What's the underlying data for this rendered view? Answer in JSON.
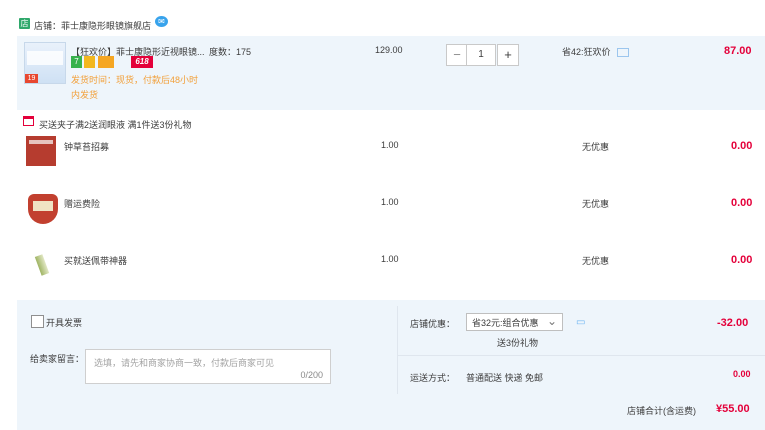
{
  "shop": {
    "icon_text": "店",
    "label": "店铺：菲士康隐形眼镜旗舰店",
    "chat_glyph": "✉"
  },
  "item": {
    "title": "【狂欢价】菲士康隐形近视眼镜...",
    "attr": "度数：175",
    "price": "129.00",
    "quantity": "1",
    "minus": "−",
    "plus": "+",
    "discount": "省42:狂欢价",
    "total": "87.00",
    "ship_info_1": "发货时间：现货，付款后48小时",
    "ship_info_2": "内发货",
    "badges": [
      "7",
      "",
      "",
      "618"
    ],
    "thumb_badge": "19"
  },
  "promo": {
    "text": "买送夹子满2送润眼液  满1件送3份礼物"
  },
  "gifts": [
    {
      "name": "钟草苔招募",
      "price": "1.00",
      "discount": "无优惠",
      "total": "0.00"
    },
    {
      "name": "赠运费险",
      "price": "1.00",
      "discount": "无优惠",
      "total": "0.00"
    },
    {
      "name": "买就送佩带神器",
      "price": "1.00",
      "discount": "无优惠",
      "total": "0.00"
    }
  ],
  "anonymous": {
    "label": "开具发票"
  },
  "message": {
    "label": "给卖家留言：",
    "placeholder": "选填，请先和商家协商一致，付款后商家可见",
    "counter": "0/200"
  },
  "shop_discount": {
    "label": "店铺优惠：",
    "selected": "省32元:组合优惠",
    "note": "送3份礼物",
    "amount": "-32.00",
    "chevron": "⌄",
    "chat_glyph": "▭"
  },
  "shipping": {
    "label": "运送方式：",
    "value": "普通配送 快递 免邮",
    "amount": "0.00"
  },
  "total": {
    "label": "店铺合计(含运费)",
    "amount": "¥55.00"
  }
}
